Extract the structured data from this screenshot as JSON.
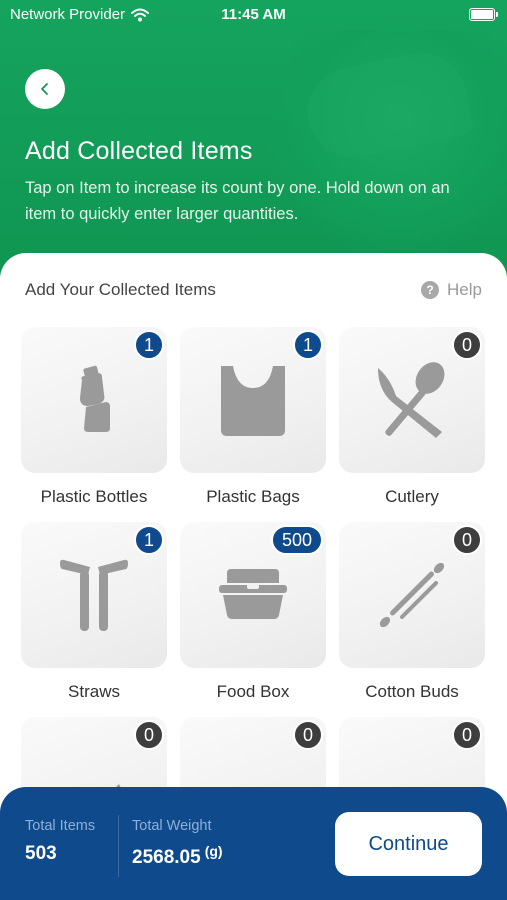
{
  "status_bar": {
    "carrier": "Network Provider",
    "time": "11:45 AM",
    "icons": [
      "wifi-icon",
      "battery-icon"
    ]
  },
  "header": {
    "back_icon": "chevron-left-icon",
    "title": "Add Collected Items",
    "subtitle": "Tap on Item to increase its count by one. Hold down on an item to quickly enter larger quantities."
  },
  "section": {
    "title": "Add Your Collected Items",
    "help_label": "Help",
    "help_icon": "question-circle-icon"
  },
  "items": [
    {
      "label": "Plastic Bottles",
      "count": "1",
      "icon": "plastic-bottle-icon"
    },
    {
      "label": "Plastic Bags",
      "count": "1",
      "icon": "plastic-bag-icon"
    },
    {
      "label": "Cutlery",
      "count": "0",
      "icon": "cutlery-icon"
    },
    {
      "label": "Straws",
      "count": "1",
      "icon": "straws-icon"
    },
    {
      "label": "Food Box",
      "count": "500",
      "icon": "food-box-icon"
    },
    {
      "label": "Cotton Buds",
      "count": "0",
      "icon": "cotton-buds-icon"
    },
    {
      "label": "",
      "count": "0",
      "icon": "candy-wrapper-icon"
    },
    {
      "label": "",
      "count": "0",
      "icon": "balloons-icon"
    },
    {
      "label": "",
      "count": "0",
      "icon": "cigarette-icon"
    }
  ],
  "summary": {
    "total_items_label": "Total Items",
    "total_items_value": "503",
    "total_weight_label": "Total Weight",
    "total_weight_value": "2568.05",
    "weight_unit": "(g)",
    "continue_label": "Continue"
  },
  "colors": {
    "header_green": "#0f9a55",
    "accent_blue": "#0e4a8c",
    "badge_zero": "#3e3e3e",
    "icon_gray": "#9a9a9a"
  }
}
